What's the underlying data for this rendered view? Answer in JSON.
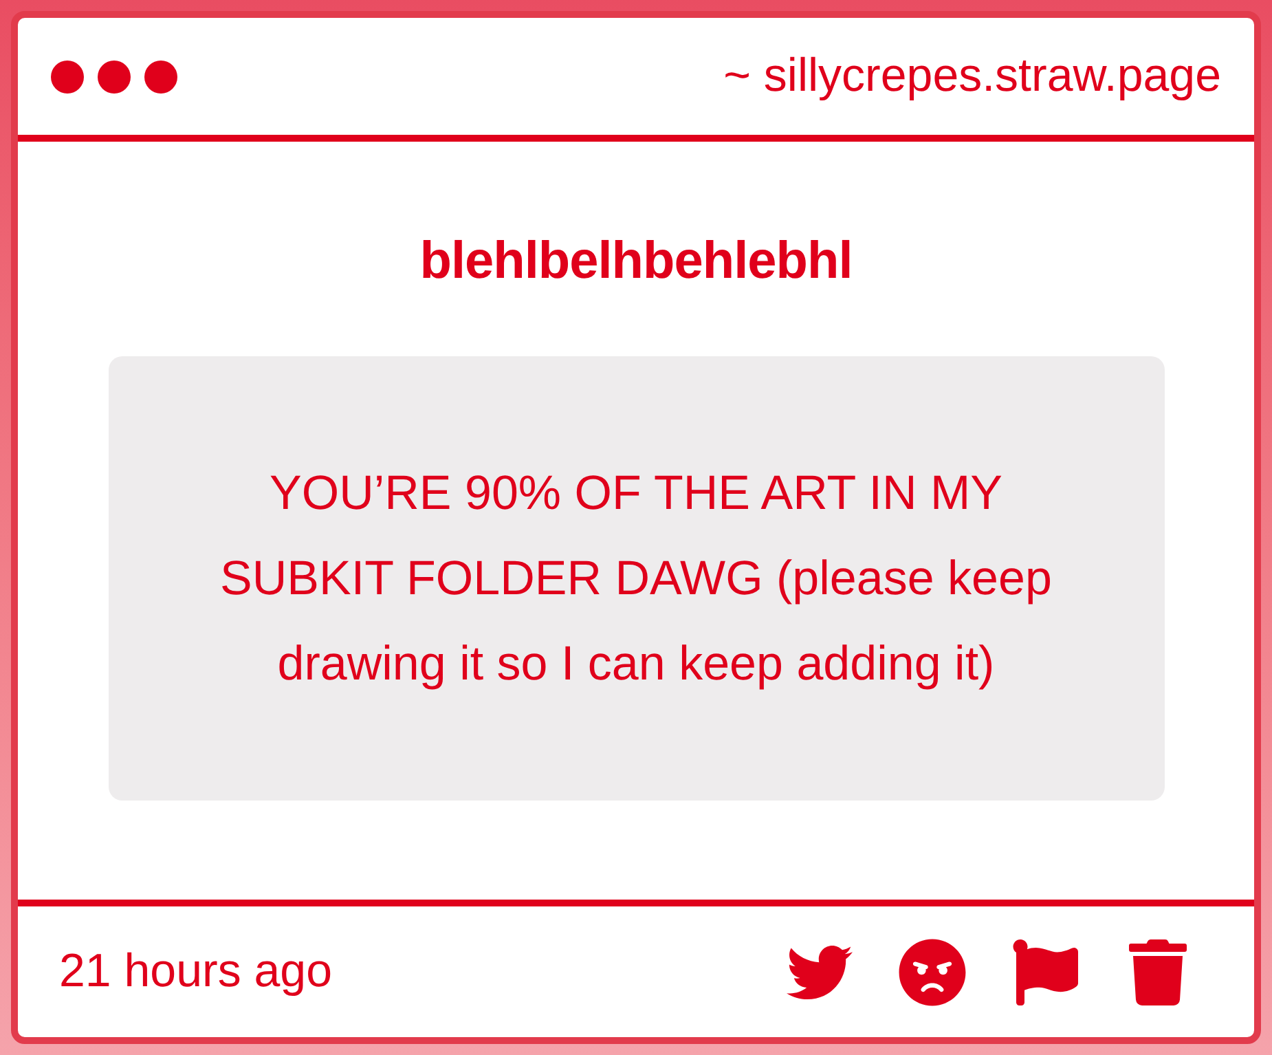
{
  "window": {
    "address": "~ sillycrepes.straw.page"
  },
  "post": {
    "title": "blehlbelhbehlebhl",
    "message": "YOU’RE 90% OF THE ART IN MY SUBKIT FOLDER DAWG (please keep drawing it so I can keep adding it)"
  },
  "footer": {
    "time": "21 hours ago",
    "actions": [
      {
        "kind": "share"
      },
      {
        "kind": "react"
      },
      {
        "kind": "report"
      },
      {
        "kind": "delete"
      }
    ]
  }
}
